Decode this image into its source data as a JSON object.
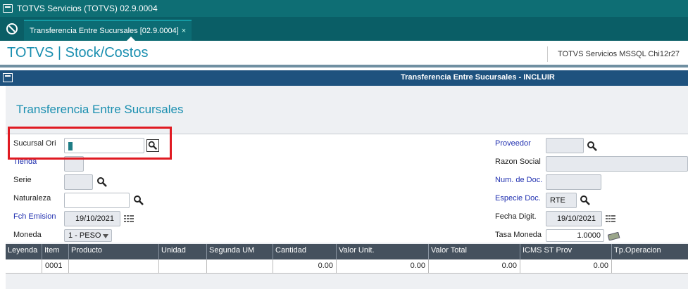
{
  "window": {
    "title": "TOTVS Servicios (TOTVS) 02.9.0004"
  },
  "tab": {
    "label": "Transferencia Entre Sucursales [02.9.0004]",
    "close": "×"
  },
  "module": {
    "name": "TOTVS | Stock/Costos",
    "server": "TOTVS Servicios MSSQL Chi12r27"
  },
  "form_window": {
    "title": "Transferencia Entre Sucursales - INCLUIR"
  },
  "form": {
    "title": "Transferencia Entre Sucursales",
    "left": {
      "sucursal_ori": {
        "label": "Sucursal Ori",
        "value": ""
      },
      "tienda": {
        "label": "Tienda",
        "value": ""
      },
      "serie": {
        "label": "Serie",
        "value": ""
      },
      "naturaleza": {
        "label": "Naturaleza",
        "value": ""
      },
      "fch_emision": {
        "label": "Fch Emision",
        "value": "19/10/2021"
      },
      "moneda": {
        "label": "Moneda",
        "value": "1 - PESO"
      }
    },
    "right": {
      "proveedor": {
        "label": "Proveedor",
        "value": ""
      },
      "razon_social": {
        "label": "Razon Social",
        "value": ""
      },
      "num_doc": {
        "label": "Num. de Doc.",
        "value": ""
      },
      "especie_doc": {
        "label": "Especie Doc.",
        "value": "RTE"
      },
      "fecha_digit": {
        "label": "Fecha Digit.",
        "value": "19/10/2021"
      },
      "tasa_moneda": {
        "label": "Tasa Moneda",
        "value": "1.0000"
      }
    }
  },
  "grid": {
    "columns": [
      "Leyenda",
      "Item",
      "Producto",
      "Unidad",
      "Segunda UM",
      "Cantidad",
      "Valor Unit.",
      "Valor Total",
      "ICMS ST Prov",
      "Tp.Operacion"
    ],
    "rows": [
      [
        "",
        "0001",
        "",
        "",
        "",
        "0.00",
        "0.00",
        "0.00",
        "0.00",
        ""
      ]
    ]
  },
  "colors": {
    "titlebar": "#0e6e74",
    "accent": "#1a8fb0",
    "highlight": "#e01a22",
    "grid_header": "#45515e"
  }
}
